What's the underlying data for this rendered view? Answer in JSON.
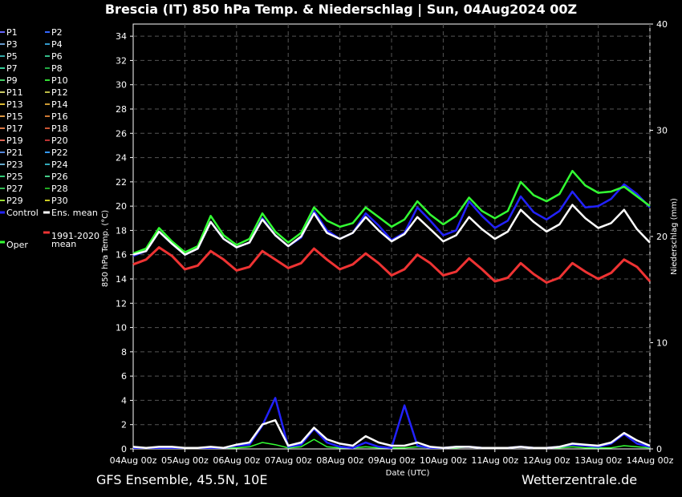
{
  "title": "Brescia  (IT)  850 hPa Temp. & Niederschlag | Sun, 04Aug2024 00Z",
  "footer_left": "GFS Ensemble, 45.5N, 10E",
  "footer_right": "Wetterzentrale.de",
  "legend": {
    "members": [
      {
        "label": "P1",
        "color": "#6666ff"
      },
      {
        "label": "P2",
        "color": "#3366ff"
      },
      {
        "label": "P3",
        "color": "#6699cc"
      },
      {
        "label": "P4",
        "color": "#3399cc"
      },
      {
        "label": "P5",
        "color": "#33aaaa"
      },
      {
        "label": "P6",
        "color": "#33bb88"
      },
      {
        "label": "P7",
        "color": "#33cc99"
      },
      {
        "label": "P8",
        "color": "#22aa44"
      },
      {
        "label": "P9",
        "color": "#44cc66"
      },
      {
        "label": "P10",
        "color": "#33dd33"
      },
      {
        "label": "P11",
        "color": "#cccc66"
      },
      {
        "label": "P12",
        "color": "#bbbb44"
      },
      {
        "label": "P13",
        "color": "#ddbb33"
      },
      {
        "label": "P14",
        "color": "#cc9933"
      },
      {
        "label": "P15",
        "color": "#dd9944"
      },
      {
        "label": "P16",
        "color": "#cc7733"
      },
      {
        "label": "P17",
        "color": "#dd7744"
      },
      {
        "label": "P18",
        "color": "#cc5533"
      },
      {
        "label": "P19",
        "color": "#dd6655"
      },
      {
        "label": "P20",
        "color": "#bb3333"
      },
      {
        "label": "P21",
        "color": "#5588dd"
      },
      {
        "label": "P22",
        "color": "#3399ff"
      },
      {
        "label": "P23",
        "color": "#66aacc"
      },
      {
        "label": "P24",
        "color": "#33aabb"
      },
      {
        "label": "P25",
        "color": "#33cc77"
      },
      {
        "label": "P26",
        "color": "#44cc88"
      },
      {
        "label": "P27",
        "color": "#33bb55"
      },
      {
        "label": "P28",
        "color": "#22aa22"
      },
      {
        "label": "P29",
        "color": "#99dd33"
      },
      {
        "label": "P30",
        "color": "#cccc22"
      }
    ],
    "control": {
      "label": "Control",
      "color": "#2222ff"
    },
    "ens_mean": {
      "label": "Ens. mean",
      "color": "#ffffff"
    },
    "oper": {
      "label": "Oper",
      "color": "#33ff33"
    },
    "climate": {
      "label_line1": "1991-2020",
      "label_line2": "mean",
      "color": "#ee3333"
    }
  },
  "chart_data": {
    "type": "line",
    "xlabel": "Date (UTC)",
    "ylabel": "850 hPa Temp. (°C)",
    "y2label": "Niederschlag (mm)",
    "ylim": [
      0,
      35
    ],
    "y2lim": [
      0,
      40
    ],
    "y_ticks": [
      0,
      2,
      4,
      6,
      8,
      10,
      12,
      14,
      16,
      18,
      20,
      22,
      24,
      26,
      28,
      30,
      32,
      34
    ],
    "y2_ticks": [
      0,
      10,
      20,
      30,
      40
    ],
    "x_tick_labels": [
      "04Aug 00z",
      "05Aug 00z",
      "06Aug 00z",
      "07Aug 00z",
      "08Aug 00z",
      "09Aug 00z",
      "10Aug 00z",
      "11Aug 00z",
      "12Aug 00z",
      "13Aug 00z",
      "14Aug 00z"
    ],
    "x_hours_step": 6,
    "grid": true,
    "temperature": {
      "ens_mean": [
        16.0,
        16.3,
        17.9,
        16.9,
        16.0,
        16.5,
        18.7,
        17.3,
        16.6,
        17.0,
        18.9,
        17.6,
        16.7,
        17.5,
        19.4,
        17.8,
        17.3,
        17.8,
        19.1,
        18.0,
        17.1,
        17.7,
        19.1,
        18.1,
        17.1,
        17.6,
        19.1,
        18.1,
        17.3,
        17.9,
        19.7,
        18.7,
        17.9,
        18.5,
        20.1,
        19.0,
        18.2,
        18.6,
        19.7,
        18.1,
        17.0
      ],
      "control": [
        15.9,
        16.3,
        17.9,
        16.9,
        16.0,
        16.5,
        18.7,
        17.3,
        16.6,
        17.0,
        19.0,
        17.6,
        16.7,
        17.4,
        19.6,
        18.0,
        17.3,
        17.8,
        19.4,
        18.4,
        17.2,
        17.8,
        19.9,
        18.8,
        17.6,
        18.0,
        20.4,
        19.2,
        18.2,
        18.8,
        20.8,
        19.5,
        18.9,
        19.6,
        21.2,
        19.9,
        20.0,
        20.6,
        21.8,
        21.0,
        19.9
      ],
      "oper": [
        16.1,
        16.5,
        18.2,
        17.1,
        16.2,
        16.7,
        19.2,
        17.6,
        16.8,
        17.3,
        19.4,
        17.9,
        17.0,
        17.8,
        19.9,
        18.8,
        18.3,
        18.6,
        19.9,
        19.1,
        18.3,
        18.9,
        20.4,
        19.3,
        18.5,
        19.2,
        20.7,
        19.6,
        19.0,
        19.6,
        22.0,
        20.9,
        20.4,
        21.0,
        22.9,
        21.7,
        21.1,
        21.2,
        21.6,
        20.8,
        20.0
      ],
      "climate_mean": [
        15.2,
        15.6,
        16.6,
        15.9,
        14.8,
        15.1,
        16.3,
        15.6,
        14.7,
        15.0,
        16.3,
        15.6,
        14.9,
        15.3,
        16.5,
        15.6,
        14.8,
        15.2,
        16.1,
        15.3,
        14.3,
        14.8,
        16.0,
        15.3,
        14.3,
        14.6,
        15.7,
        14.8,
        13.8,
        14.1,
        15.3,
        14.4,
        13.7,
        14.1,
        15.3,
        14.6,
        14.0,
        14.5,
        15.6,
        15.0,
        13.8
      ]
    },
    "precipitation_mm": {
      "ens_mean": [
        0.2,
        0.1,
        0.2,
        0.2,
        0.1,
        0.1,
        0.2,
        0.1,
        0.4,
        0.6,
        2.3,
        2.7,
        0.3,
        0.6,
        2.0,
        0.9,
        0.5,
        0.3,
        1.2,
        0.6,
        0.3,
        0.3,
        0.6,
        0.2,
        0.1,
        0.2,
        0.2,
        0.1,
        0.1,
        0.1,
        0.2,
        0.1,
        0.1,
        0.2,
        0.5,
        0.4,
        0.3,
        0.6,
        1.5,
        0.8,
        0.3
      ],
      "control": [
        0.1,
        0.1,
        0.1,
        0.1,
        0.1,
        0.1,
        0.1,
        0.1,
        0.3,
        0.4,
        2.2,
        4.8,
        0.2,
        0.4,
        1.9,
        0.6,
        0.2,
        0.1,
        0.6,
        0.2,
        0.1,
        4.1,
        0.3,
        0.1,
        0.1,
        0.2,
        0.2,
        0.1,
        0.1,
        0.1,
        0.2,
        0.1,
        0.1,
        0.2,
        0.4,
        0.3,
        0.2,
        0.5,
        1.4,
        0.5,
        0.2
      ],
      "oper": [
        0.1,
        0.1,
        0.1,
        0.2,
        0.1,
        0.1,
        0.1,
        0.1,
        0.1,
        0.2,
        0.6,
        0.4,
        0.1,
        0.2,
        0.9,
        0.2,
        0.1,
        0.1,
        0.2,
        0.1,
        0.1,
        0.1,
        0.2,
        0.1,
        0.1,
        0.1,
        0.2,
        0.1,
        0.1,
        0.1,
        0.2,
        0.1,
        0.1,
        0.1,
        0.2,
        0.1,
        0.1,
        0.1,
        0.3,
        0.2,
        0.1
      ]
    }
  }
}
